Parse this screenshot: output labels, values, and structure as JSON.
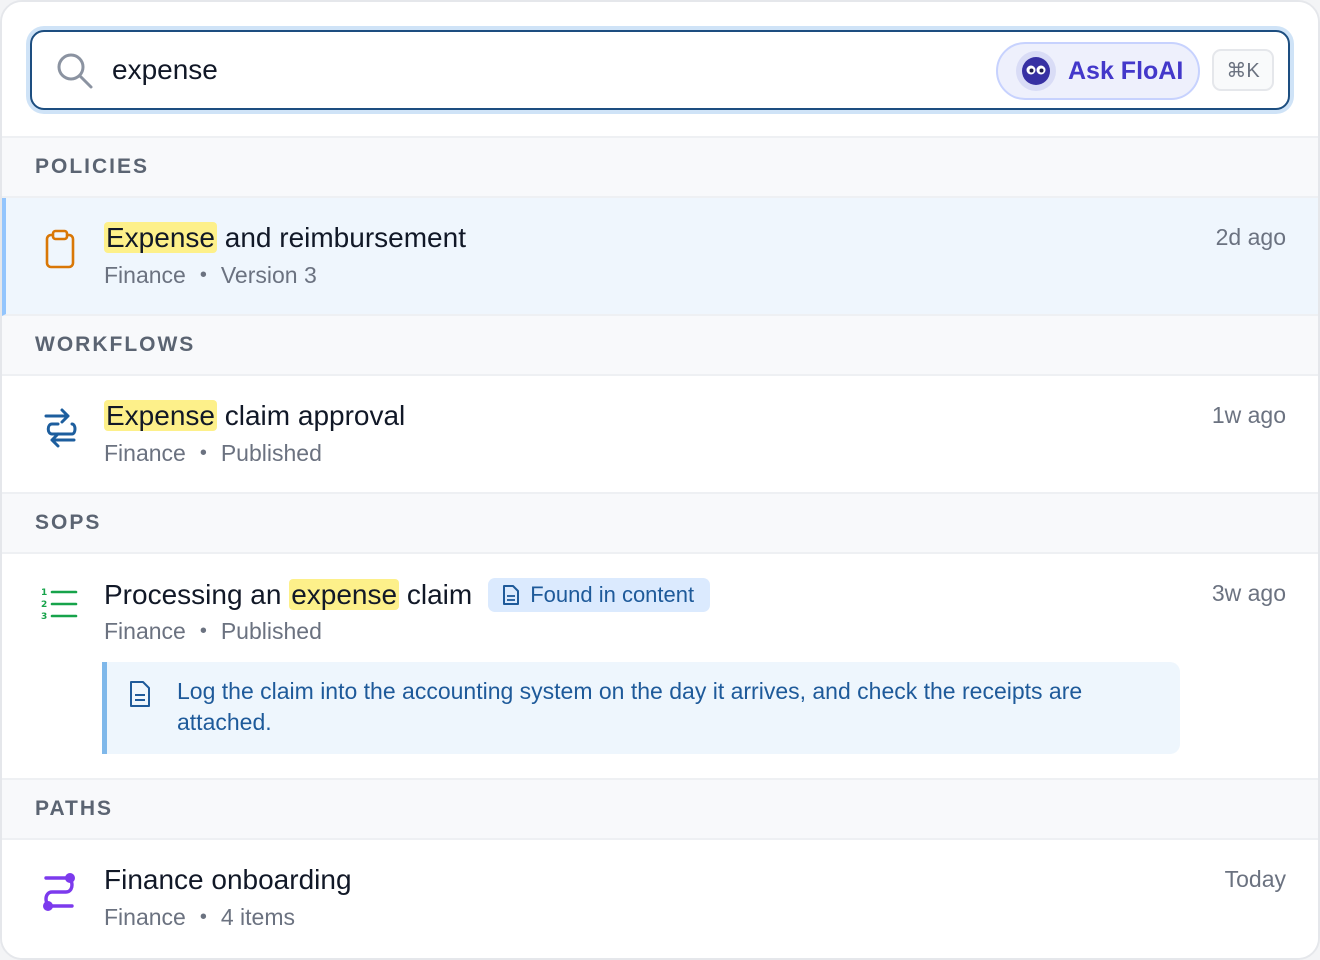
{
  "search": {
    "query": "expense",
    "ask_label": "Ask FloAI",
    "shortcut": "⌘K"
  },
  "sections": [
    {
      "header": "POLICIES",
      "results": [
        {
          "icon": "clipboard-icon",
          "title_highlight": "Expense",
          "title_rest": " and reimbursement",
          "category": "Finance",
          "meta": "Version 3",
          "time": "2d ago"
        }
      ]
    },
    {
      "header": "WORKFLOWS",
      "results": [
        {
          "icon": "workflow-icon",
          "title_highlight": "Expense",
          "title_rest": " claim approval",
          "category": "Finance",
          "meta": "Published",
          "time": "1w ago"
        }
      ]
    },
    {
      "header": "SOPS",
      "results": [
        {
          "icon": "numbered-list-icon",
          "title_prefix": "Processing an ",
          "title_highlight": "expense",
          "title_rest": " claim",
          "badge": "Found in content",
          "category": "Finance",
          "meta": "Published",
          "time": "3w ago",
          "snippet": "Log the claim into the accounting system on the day it arrives, and check the receipts are attached."
        }
      ]
    },
    {
      "header": "PATHS",
      "results": [
        {
          "icon": "path-icon",
          "title": "Finance onboarding",
          "category": "Finance",
          "meta": "4 items",
          "time": "Today"
        }
      ]
    }
  ],
  "colors": {
    "accent": "#1d4e80",
    "highlight": "#fdf08a",
    "ask_text": "#4338ca",
    "policy_icon": "#d97706",
    "workflow_icon": "#1d5e9e",
    "sop_icon": "#16a34a",
    "path_icon": "#7c3aed"
  }
}
